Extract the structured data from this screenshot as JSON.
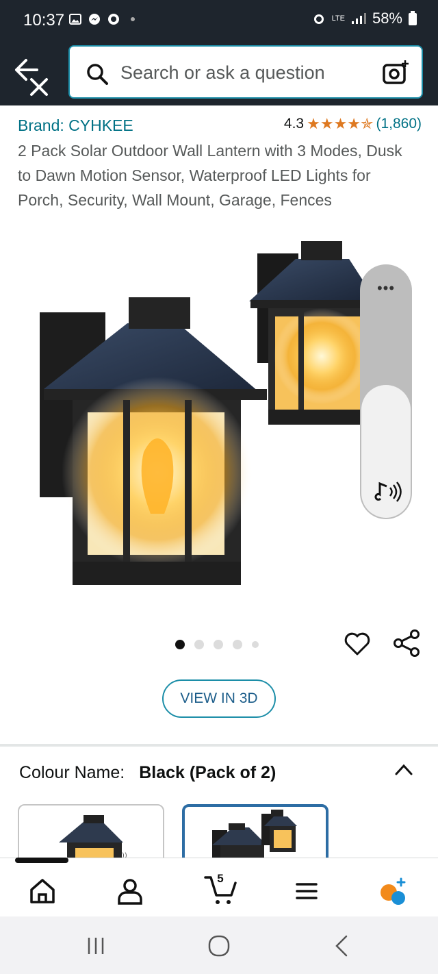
{
  "status_bar": {
    "time": "10:37",
    "network": "LTE",
    "battery": "58%"
  },
  "search": {
    "placeholder": "Search or ask a question"
  },
  "product": {
    "brand": "Brand: CYHKEE",
    "rating": "4.3",
    "stars": "★★★★✯",
    "rating_value": 4.3,
    "review_count": "(1,860)",
    "title": "2 Pack Solar Outdoor Wall Lantern with 3 Modes, Dusk to Dawn Motion Sensor, Waterproof LED Lights for Porch, Security, Wall Mount, Garage, Fences"
  },
  "carousel": {
    "total_images": 5,
    "active_index": 0
  },
  "view_3d": {
    "label": "VIEW IN 3D"
  },
  "variation": {
    "label": "Colour Name:",
    "value": "Black (Pack of 2)",
    "selected_swatch": 1
  },
  "bottom_nav": {
    "cart_count": "5",
    "items": [
      "home-icon",
      "account-icon",
      "cart-icon",
      "menu-icon",
      "rufus-icon"
    ]
  },
  "colors": {
    "header_bg": "#1e252d",
    "link": "#007185",
    "star": "#de7921",
    "accent_border": "#1c8ea8",
    "selected_swatch_border": "#2d6da4"
  }
}
